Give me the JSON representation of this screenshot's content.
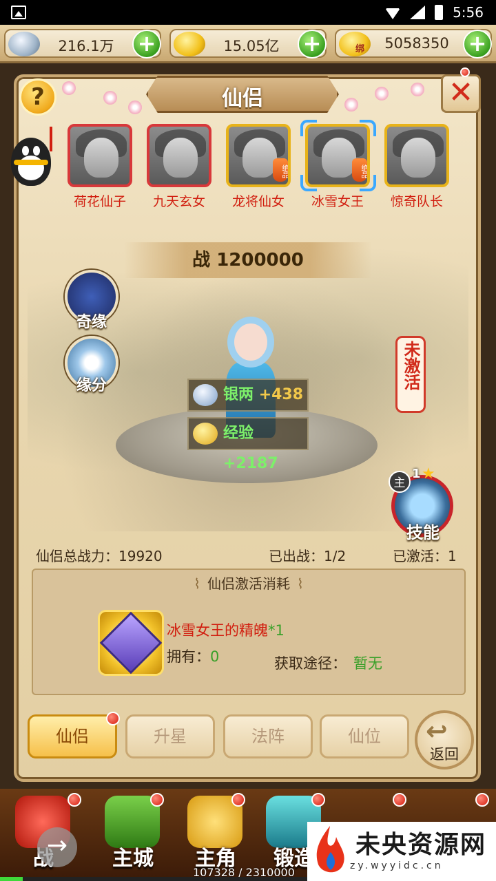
{
  "status_bar": {
    "time": "5:56"
  },
  "currency": {
    "silver": "216.1万",
    "gold": "15.05亿",
    "bound_gold": "5058350",
    "bound_tag": "绑"
  },
  "panel": {
    "title": "仙侣",
    "help": "?",
    "close": "✕"
  },
  "heroes": [
    {
      "name": "荷花仙子",
      "frame": "red"
    },
    {
      "name": "九天玄女",
      "frame": "red"
    },
    {
      "name": "龙将仙女",
      "frame": "gold",
      "badge": "绝品"
    },
    {
      "name": "冰雪女王",
      "frame": "gold",
      "badge": "绝品",
      "selected": true
    },
    {
      "name": "惊奇队长",
      "frame": "gold"
    }
  ],
  "power": "战 1200000",
  "side_buttons": {
    "fate": "奇缘",
    "bond": "缘分"
  },
  "status_tag": "未激活",
  "rewards": {
    "silver": {
      "label": "银两",
      "value": "+438"
    },
    "exp": {
      "label": "经验",
      "value": "+2187"
    }
  },
  "skill": {
    "main": "主",
    "level": "1",
    "label": "技能"
  },
  "stats": {
    "total_power": "仙侣总战力：19920",
    "deployed": "已出战：1/2",
    "activated": "已激活：1"
  },
  "cost": {
    "title": "仙侣激活消耗",
    "item_name": "冰雪女王的精魄",
    "item_qty": "*1",
    "own_label": "拥有：",
    "own_value": "0",
    "source_label": "获取途径：",
    "source_value": "暂无"
  },
  "tabs": [
    "仙侣",
    "升星",
    "法阵",
    "仙位"
  ],
  "back": "返回",
  "nav": [
    "战",
    "主城",
    "主角",
    "锻造"
  ],
  "exp": {
    "text": "107328 / 2310000",
    "fraction": 0.046
  },
  "watermark": {
    "title": "未央资源网",
    "url": "zy.wyyidc.cn"
  },
  "colors": {
    "accent_red": "#d11f10",
    "accent_green": "#3aa02a",
    "select_blue": "#3aa8ff"
  }
}
